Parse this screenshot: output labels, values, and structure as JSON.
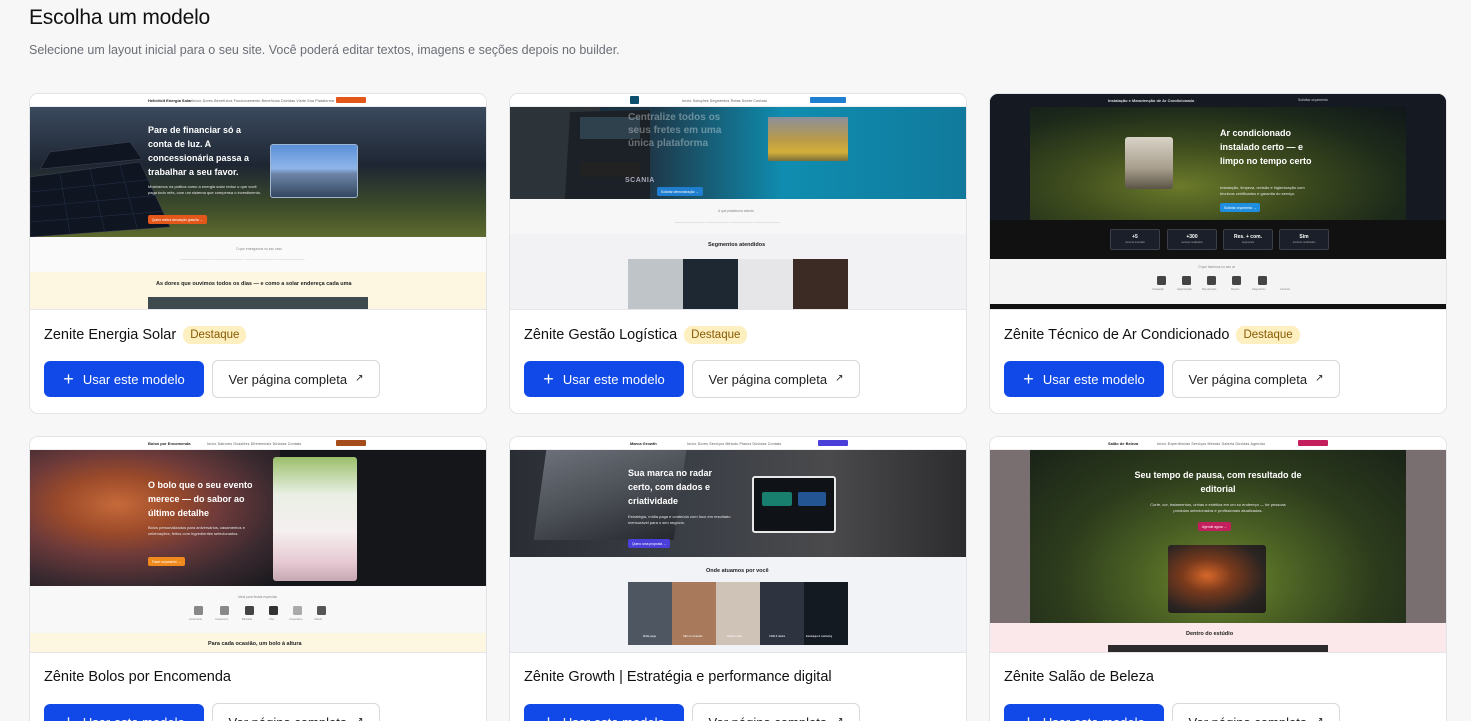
{
  "page": {
    "title": "Escolha um modelo",
    "subtitle": "Selecione um layout inicial para o seu site. Você poderá editar textos, imagens e seções depois no builder."
  },
  "buttons": {
    "use_label": "Usar este modelo",
    "view_label": "Ver página completa"
  },
  "colors": {
    "primary": "#1149e8",
    "badge_bg": "#fdefc0",
    "badge_text": "#8a5a00"
  },
  "templates": [
    {
      "name": "Zenite Energia Solar",
      "badge": "Destaque",
      "preview": {
        "brand": "HelioVolt Energia Solar",
        "nav_links": "Início   Dores   Benefícios   Funcionamento   Benefícios   Dúvidas   Visite Sua Plataforma",
        "cta": "Simular economia",
        "headline": "Pare de financiar só a conta de luz. A concessionária passa a trabalhar a seu favor.",
        "body": "Mostramos na prática como a energia solar reduz o que você paga todo mês, com um sistema que compensa o investimento.",
        "hero_cta": "Quero minha simulação gratuita  →",
        "trust_title": "O que entregamos no seu caso",
        "section_title": "As dores que ouvimos todos os dias — e como a solar endereça cada uma"
      }
    },
    {
      "name": "Zênite Gestão Logística",
      "badge": "Destaque",
      "preview": {
        "nav_links": "Início   Soluções   Segmentos   Rotas   Sobre   Contato",
        "cta": "Solicitar demonstração",
        "headline": "Centralize todos os seus fretes em uma única plataforma",
        "truck_text": "SCANIA",
        "hero_cta": "Solicitar demonstração  →",
        "trust_title": "A que plataforma atende",
        "section_title": "Segmentos atendidos"
      }
    },
    {
      "name": "Zênite Técnico de Ar Condicionado",
      "badge": "Destaque",
      "preview": {
        "brand": "Instalação e Manutenção de Ar Condicionado",
        "cta": "Solicitar orçamento",
        "headline": "Ar condicionado instalado certo — e limpo no tempo certo",
        "body": "Instalação, limpeza, revisão e higienização com técnicos certificados e garantia do serviço.",
        "hero_cta": "Solicitar orçamento  →",
        "stats": [
          {
            "value": "+5",
            "label": "anos de mercado"
          },
          {
            "value": "+300",
            "label": "serviços realizados"
          },
          {
            "value": "Res. + com.",
            "label": "segmentos"
          },
          {
            "value": "Sim",
            "label": "técnicos certificados"
          }
        ],
        "trust_title": "O que fazemos no seu ar",
        "icon_labels": [
          "Instalação",
          "Higienização",
          "Manutenção",
          "Reparo",
          "Diagnóstico",
          "Contrato"
        ]
      }
    },
    {
      "name": "Zênite Bolos por Encomenda",
      "badge": "",
      "preview": {
        "brand": "Bolos por Encomenda",
        "nav_links": "Início   Sabores   Ocasiões   Diferenciais   Dúvidas   Contato",
        "cta": "Fazer encomenda",
        "headline": "O bolo que o seu evento merece — do sabor ao último detalhe",
        "body": "Bolos personalizados para aniversários, casamentos e celebrações, feitos com ingredientes selecionados.",
        "hero_cta": "Fazer orçamento  →",
        "trust_title": "Ideal para festas especiais",
        "icon_labels": [
          "Aniversário",
          "Casamento",
          "Batizado",
          "Chá",
          "Corporativo",
          "Infantil"
        ],
        "section_title": "Para cada ocasião, um bolo à altura"
      }
    },
    {
      "name": "Zênite Growth | Estratégia e performance digital",
      "badge": "",
      "preview": {
        "brand": "Marca Growth",
        "nav_links": "Início   Dores   Serviços   Método   Planos   Dúvidas   Contato",
        "cta": "Quero crescer",
        "headline": "Sua marca no radar certo, com dados e criatividade",
        "body": "Estratégia, mídia paga e conteúdo com foco em resultado mensurável para o seu negócio.",
        "hero_cta": "Quero uma proposta  →",
        "section_title": "Onde atuamos por você",
        "tile_labels": [
          "Mídia paga",
          "SEO & conteúdo",
          "Social media",
          "CRM & dados",
          "Estratégia & marketing"
        ]
      }
    },
    {
      "name": "Zênite Salão de Beleza",
      "badge": "",
      "preview": {
        "brand": "Salão de Beleza",
        "nav_links": "Início   Experiências   Serviços   Método   Galeria   Dúvidas   Agendar",
        "cta": "Agendar horário",
        "headline": "Seu tempo de pausa, com resultado de editorial",
        "body": "Corte, cor, tratamentos, unhas e estética em um só endereço — for pessoas produtos selecionados e profissionais atualizadas.",
        "hero_cta": "Agende agora  →",
        "section_title": "Dentro do estúdio"
      }
    }
  ]
}
